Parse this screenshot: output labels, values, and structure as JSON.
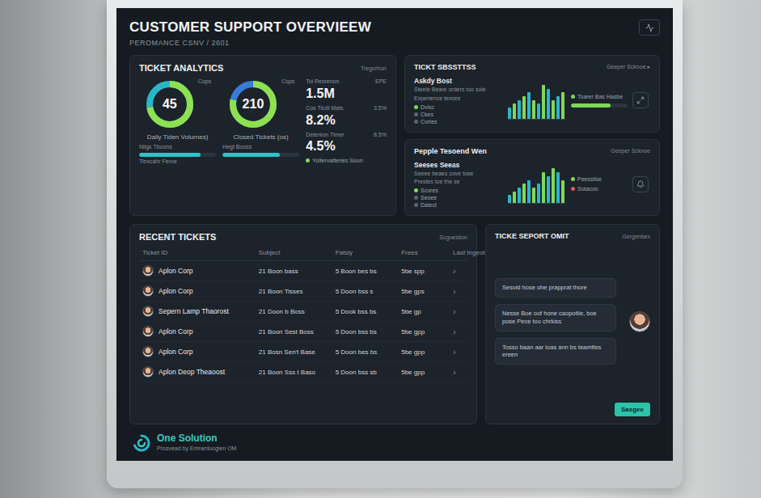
{
  "header": {
    "title": "CUSTOMER SUPPORT OVERVIEEW",
    "subtitle": "PEROMANCE CSNV / 2601"
  },
  "ticket_analytics": {
    "title": "TICKET ANALYTICS",
    "caption": "Tregorhon",
    "donuts": [
      {
        "value": "45",
        "legend": "Cops",
        "label": "Daily Tiden Volurnes)",
        "level": 0.72,
        "bar_label": "Nligs Tboons",
        "bar_caption": "Tinxcahr Feroe",
        "bar_level": 0.8
      },
      {
        "value": "210",
        "legend": "Cops",
        "label": "Closed Tickets (os)",
        "level": 0.78,
        "bar_label": "Hegt Booss",
        "bar_caption": "",
        "bar_level": 0.75
      }
    ],
    "stats": [
      {
        "label": "Tol Resrenon",
        "value": "1.5M",
        "delta": "EPE"
      },
      {
        "label": "Cos Ticdt Mats",
        "value": "8.2%",
        "delta": "3.5%"
      },
      {
        "label": "Detenion Timer",
        "value": "4.5%",
        "delta": "8.5%"
      }
    ],
    "legend": {
      "label": "Yoltervatteries Soon",
      "color": "#7ed957"
    }
  },
  "sections": [
    {
      "title": "TICKT SBSSTTSS",
      "link": "Geeper Scknoe ▸",
      "name": "Askdy Bost",
      "lines": [
        "Steele Beare orders too sole",
        "Experience lences"
      ],
      "legend": [
        {
          "label": "Dvisc",
          "color": "#7ed957"
        },
        {
          "label": "Ckes",
          "color": "#5b6670"
        },
        {
          "label": "Cortes",
          "color": "#5b6670"
        }
      ],
      "series": [
        {
          "color": "#2bb5c9",
          "values": [
            3,
            5,
            7,
            4,
            8,
            6
          ]
        },
        {
          "color": "#7ed957",
          "values": [
            4,
            6,
            5,
            9,
            5,
            7
          ]
        }
      ],
      "side": [
        {
          "kind": "legend",
          "label": "Toarer Bas Hasbe",
          "color": "#7ed957"
        },
        {
          "kind": "bar",
          "level": 0.7,
          "color": "#7ed957"
        }
      ]
    },
    {
      "title": "Pepple Tesoend Wen",
      "link": "Geeper Scknoe",
      "name": "Seeses Seeas",
      "lines": [
        "Seeee beaes cove tose",
        "Prestes toe the se"
      ],
      "legend": [
        {
          "label": "Scores",
          "color": "#7ed957"
        },
        {
          "label": "Seoee",
          "color": "#5b6670"
        },
        {
          "label": "Dalect",
          "color": "#5b6670"
        }
      ],
      "series": [
        {
          "color": "#2bb5c9",
          "values": [
            2,
            4,
            6,
            5,
            7,
            8
          ]
        },
        {
          "color": "#7ed957",
          "values": [
            3,
            5,
            4,
            8,
            9,
            6
          ]
        }
      ],
      "side": [
        {
          "kind": "legend",
          "label": "Peesslise",
          "color": "#7ed957"
        },
        {
          "kind": "legend",
          "label": "Sotacoo",
          "color": "#e0584f"
        }
      ]
    }
  ],
  "recent_tickets": {
    "title": "RECENT TICKETS",
    "caption": "Scguestion",
    "columns": [
      "Ticket ID",
      "Subject",
      "Fatsly",
      "Frees",
      "Last Ingeotss"
    ],
    "rows": [
      {
        "company": "Aplon Corp",
        "subject": "21 Boon bass",
        "priority": "5 Boon bes bs",
        "time": "5be spp",
        "arrow": "›"
      },
      {
        "company": "Aplon Corp",
        "subject": "21 Boon Tisses",
        "priority": "5 Doon bss s",
        "time": "5be gps",
        "arrow": "›"
      },
      {
        "company": "Sepern Lamp Thaorost",
        "subject": "21 Doon b Boss",
        "priority": "5 Dook bss bs",
        "time": "5be gp",
        "arrow": "›"
      },
      {
        "company": "Aplon Corp",
        "subject": "21 Boon Sest Boss",
        "priority": "5 Doon bss bs",
        "time": "5be gpp",
        "arrow": "›"
      },
      {
        "company": "Aplon Corp",
        "subject": "21 Bosn Sen't Base",
        "priority": "5 Doon bes bs",
        "time": "5be gpp",
        "arrow": "›"
      },
      {
        "company": "Aplon Deop Theaoost",
        "subject": "21 Boon Sss t Baso",
        "priority": "5 Doon bss sb",
        "time": "5be gpp",
        "arrow": "›"
      }
    ]
  },
  "chat": {
    "title": "TICKE SEPORT OMIT",
    "caption": "Gergenbex",
    "messages": [
      "Sesvid hose ohe prapprat thore",
      "Nesse Boe oof hone caopotlie, boe pose Pece too chrkiss",
      "Tosso baan aar loas ann bs teamttes ereen"
    ],
    "button": "Sasgee"
  },
  "footer": {
    "name": "One Solution",
    "tagline": "Prosvead by Emrwnloogien OM"
  }
}
